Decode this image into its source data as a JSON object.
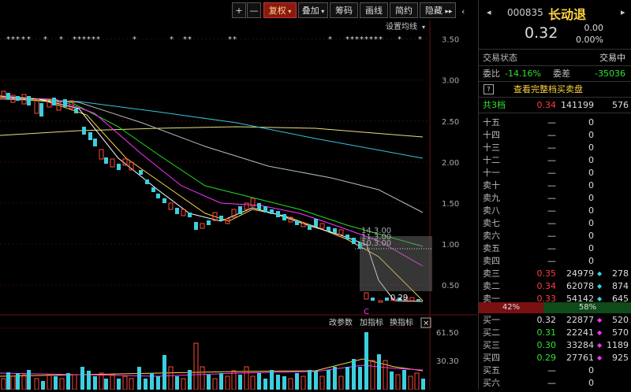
{
  "toolbar": {
    "plus": "+",
    "minus": "—",
    "fuquan": "复权",
    "diejia": "叠加",
    "choumao": "筹码",
    "huaxian": "画线",
    "jianyue": "简约",
    "yincang": "隐藏",
    "arrows": "▸▸"
  },
  "chart": {
    "settings_label": "设置均线",
    "y_ticks": [
      "3.50",
      "3.00",
      "2.50",
      "2.00",
      "1.50",
      "1.00",
      "0.50"
    ],
    "price_annot": "0.29",
    "marker_c": "C",
    "overlay_lines": [
      "14.3.00",
      "11.3.00",
      "10.3.00"
    ],
    "vol_ticks": [
      "61.50",
      "30.30"
    ],
    "vol_toolbar": {
      "params": "改参数",
      "add": "加指标",
      "switch": "换指标",
      "close": "✕"
    }
  },
  "chart_data": {
    "type": "candlestick",
    "ylim": [
      0.27,
      3.65
    ],
    "ma_legend_colors": [
      "#ffffff",
      "#ffd23f",
      "#ff33ff",
      "#22dd22",
      "#bbbbbb",
      "#33c6d8",
      "#e8e07a"
    ]
  },
  "quote": {
    "code": "000835",
    "name": "长动退",
    "price": "0.32",
    "change": "0.00",
    "change_pct": "0.00%",
    "status_label": "交易状态",
    "status_value": "交易中",
    "weibi_label": "委比",
    "weibi_value": "-14.16%",
    "weicha_label": "委差",
    "weicha_value": "-35036",
    "full_book": "查看完整档买卖盘",
    "total_levels_label": "共3档",
    "total_price": "0.34",
    "total_vol": "141199",
    "total_count": "576",
    "sell_levels": [
      {
        "label": "十五",
        "price": "—",
        "vol": "0",
        "cnt": ""
      },
      {
        "label": "十四",
        "price": "—",
        "vol": "0",
        "cnt": ""
      },
      {
        "label": "十三",
        "price": "—",
        "vol": "0",
        "cnt": ""
      },
      {
        "label": "十二",
        "price": "—",
        "vol": "0",
        "cnt": ""
      },
      {
        "label": "十一",
        "price": "—",
        "vol": "0",
        "cnt": ""
      },
      {
        "label": "卖十",
        "price": "—",
        "vol": "0",
        "cnt": ""
      },
      {
        "label": "卖九",
        "price": "—",
        "vol": "0",
        "cnt": ""
      },
      {
        "label": "卖八",
        "price": "—",
        "vol": "0",
        "cnt": ""
      },
      {
        "label": "卖七",
        "price": "—",
        "vol": "0",
        "cnt": ""
      },
      {
        "label": "卖六",
        "price": "—",
        "vol": "0",
        "cnt": ""
      },
      {
        "label": "卖五",
        "price": "—",
        "vol": "0",
        "cnt": ""
      },
      {
        "label": "卖四",
        "price": "—",
        "vol": "0",
        "cnt": ""
      },
      {
        "label": "卖三",
        "price": "0.35",
        "vol": "24979",
        "cnt": "278"
      },
      {
        "label": "卖二",
        "price": "0.34",
        "vol": "62078",
        "cnt": "874"
      },
      {
        "label": "卖一",
        "price": "0.33",
        "vol": "54142",
        "cnt": "645"
      }
    ],
    "ratio_left": "42%",
    "ratio_right": "58%",
    "buy_levels": [
      {
        "label": "买一",
        "price": "0.32",
        "vol": "22877",
        "cnt": "520"
      },
      {
        "label": "买二",
        "price": "0.31",
        "vol": "22241",
        "cnt": "570"
      },
      {
        "label": "买三",
        "price": "0.30",
        "vol": "33284",
        "cnt": "1189"
      },
      {
        "label": "买四",
        "price": "0.29",
        "vol": "27761",
        "cnt": "925"
      },
      {
        "label": "买五",
        "price": "—",
        "vol": "0",
        "cnt": ""
      },
      {
        "label": "买六",
        "price": "—",
        "vol": "0",
        "cnt": ""
      }
    ]
  }
}
